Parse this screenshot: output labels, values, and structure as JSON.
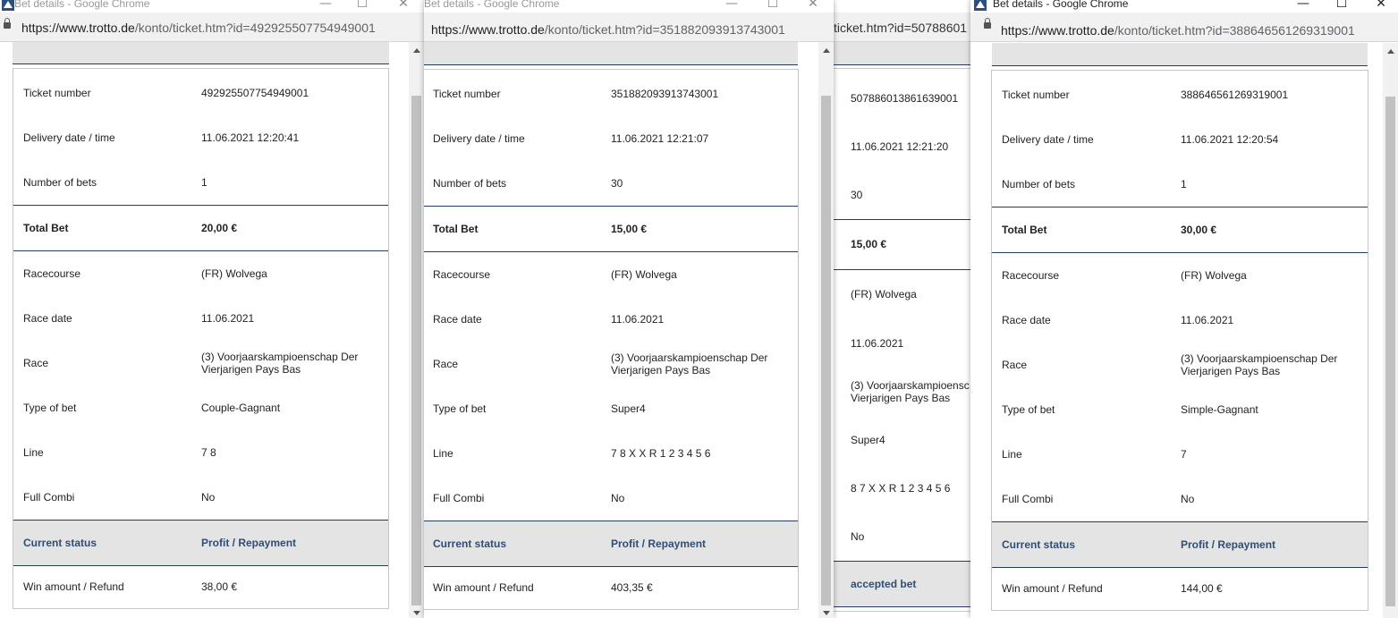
{
  "windows": [
    {
      "title": "Bet details - Google Chrome",
      "url_host": "https://www.trotto.de",
      "url_path": "/konto/ticket.htm?id=492925507754949001",
      "ticket_number": "492925507754949001",
      "delivery": "11.06.2021 12:20:41",
      "num_bets": "1",
      "total_bet": "20,00 €",
      "racecourse": "(FR) Wolvega",
      "race_date": "11.06.2021",
      "race": "(3) Voorjaarskampioenschap Der Vierjarigen Pays Bas",
      "type_of_bet": "Couple-Gagnant",
      "line": "7 8",
      "full_combi": "No",
      "status_label": "Current status",
      "status_value": "Profit / Repayment",
      "win_amount": "38,00 €"
    },
    {
      "title": "Bet details - Google Chrome",
      "url_host": "https://www.trotto.de",
      "url_path": "/konto/ticket.htm?id=351882093913743001",
      "ticket_number": "351882093913743001",
      "delivery": "11.06.2021 12:21:07",
      "num_bets": "30",
      "total_bet": "15,00 €",
      "racecourse": "(FR) Wolvega",
      "race_date": "11.06.2021",
      "race": "(3) Voorjaarskampioenschap Der Vierjarigen Pays Bas",
      "type_of_bet": "Super4",
      "line": "7 8 X X R 1 2 3 4 5 6",
      "full_combi": "No",
      "status_label": "Current status",
      "status_value": "Profit / Repayment",
      "win_amount": "403,35 €"
    },
    {
      "url_partial": "ticket.htm?id=50788601",
      "ticket_number": "507886013861639001",
      "delivery": "11.06.2021 12:21:20",
      "num_bets": "30",
      "total_bet": "15,00 €",
      "racecourse": "(FR) Wolvega",
      "race_date": "11.06.2021",
      "race_line1": "(3) Voorjaarskampioensc",
      "race_line2": "Vierjarigen Pays Bas",
      "type_of_bet": "Super4",
      "line": "8 7 X X R 1 2 3 4 5 6",
      "full_combi": "No",
      "status_value": "accepted bet"
    },
    {
      "title": "Bet details - Google Chrome",
      "url_host": "https://www.trotto.de",
      "url_path": "/konto/ticket.htm?id=388646561269319001",
      "ticket_number": "388646561269319001",
      "delivery": "11.06.2021 12:20:54",
      "num_bets": "1",
      "total_bet": "30,00 €",
      "racecourse": "(FR) Wolvega",
      "race_date": "11.06.2021",
      "race": "(3) Voorjaarskampioenschap Der Vierjarigen Pays Bas",
      "type_of_bet": "Simple-Gagnant",
      "line": "7",
      "full_combi": "No",
      "status_label": "Current status",
      "status_value": "Profit / Repayment",
      "win_amount": "144,00 €"
    }
  ],
  "labels": {
    "ticket_number": "Ticket number",
    "delivery": "Delivery date / time",
    "num_bets": "Number of bets",
    "total_bet": "Total Bet",
    "racecourse": "Racecourse",
    "race_date": "Race date",
    "race": "Race",
    "type_of_bet": "Type of bet",
    "line": "Line",
    "full_combi": "Full Combi",
    "win_amount": "Win amount / Refund"
  },
  "window_controls": {
    "minimize": "—",
    "maximize": "☐",
    "close": "✕"
  },
  "colors": {
    "navy": "#243a5e",
    "status_text": "#2f4d77",
    "band": "#e4e4e4"
  }
}
